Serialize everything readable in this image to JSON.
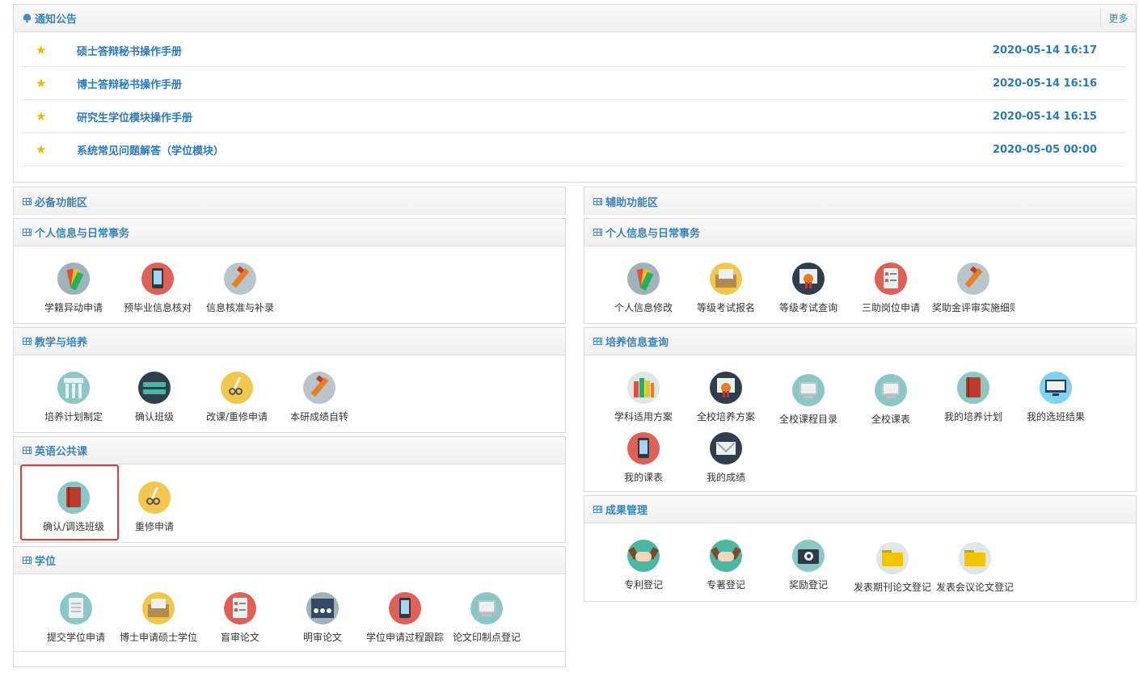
{
  "notice": {
    "title": "通知公告",
    "more": "更多",
    "items": [
      {
        "title": "硕士答辩秘书操作手册",
        "date": "2020-05-14 16:17"
      },
      {
        "title": "博士答辩秘书操作手册",
        "date": "2020-05-14 16:16"
      },
      {
        "title": "研究生学位模块操作手册",
        "date": "2020-05-14 16:15"
      },
      {
        "title": "系统常见问题解答（学位模块）",
        "date": "2020-05-05 00:00"
      }
    ]
  },
  "left": {
    "required": {
      "title": "必备功能区"
    },
    "personal": {
      "title": "个人信息与日常事务",
      "items": [
        "学籍异动申请",
        "预毕业信息核对",
        "信息核准与补录"
      ]
    },
    "teaching": {
      "title": "教学与培养",
      "items": [
        "培养计划制定",
        "确认班级",
        "改课/重修申请",
        "本研成绩自转"
      ]
    },
    "english": {
      "title": "英语公共课",
      "items": [
        "确认/调选班级",
        "重修申请"
      ]
    },
    "degree": {
      "title": "学位",
      "items": [
        "提交学位申请",
        "博士申请硕士学位",
        "盲审论文",
        "明审论文",
        "学位申请过程跟踪",
        "论文印制点登记"
      ]
    }
  },
  "right": {
    "aux": {
      "title": "辅助功能区"
    },
    "personal": {
      "title": "个人信息与日常事务",
      "items": [
        "个人信息修改",
        "等级考试报名",
        "等级考试查询",
        "三助岗位申请",
        "奖助金评审实施细则"
      ]
    },
    "training": {
      "title": "培养信息查询",
      "items": [
        "学科适用方案",
        "全校培养方案",
        "全校课程目录",
        "全校课表",
        "我的培养计划",
        "我的选班结果",
        "我的课表",
        "我的成绩"
      ]
    },
    "results": {
      "title": "成果管理",
      "items": [
        "专利登记",
        "专著登记",
        "奖励登记",
        "发表期刊论文登记",
        "发表会议论文登记"
      ]
    }
  }
}
